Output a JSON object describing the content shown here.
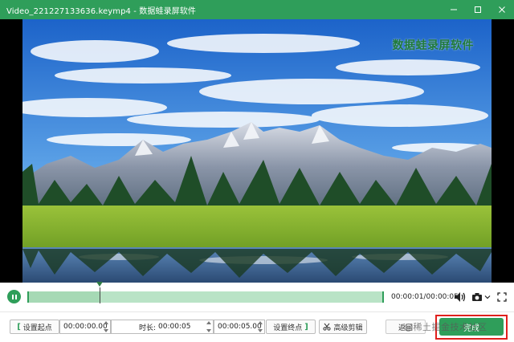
{
  "window": {
    "title": "Video_221227133636.keymp4  -  数据蛙录屏软件"
  },
  "video": {
    "watermark": "数据蛙录屏软件"
  },
  "playback": {
    "progress_fraction": 0.2,
    "time_display": "00:00:01/00:00:05"
  },
  "toolbar": {
    "set_start_label": "设置起点",
    "start_time_value": "00:00:00.00",
    "duration_label": "时长:",
    "duration_value": "00:00:05",
    "end_time_value": "00:00:05.00",
    "set_end_label": "设置终点",
    "advanced_edit_label": "高级剪辑",
    "back_label": "返回",
    "save_label": "完成"
  },
  "overlay": {
    "site_watermark": "@稀土掘金技术社区"
  },
  "colors": {
    "accent": "#2f9e5a",
    "highlight": "#e0201d"
  }
}
